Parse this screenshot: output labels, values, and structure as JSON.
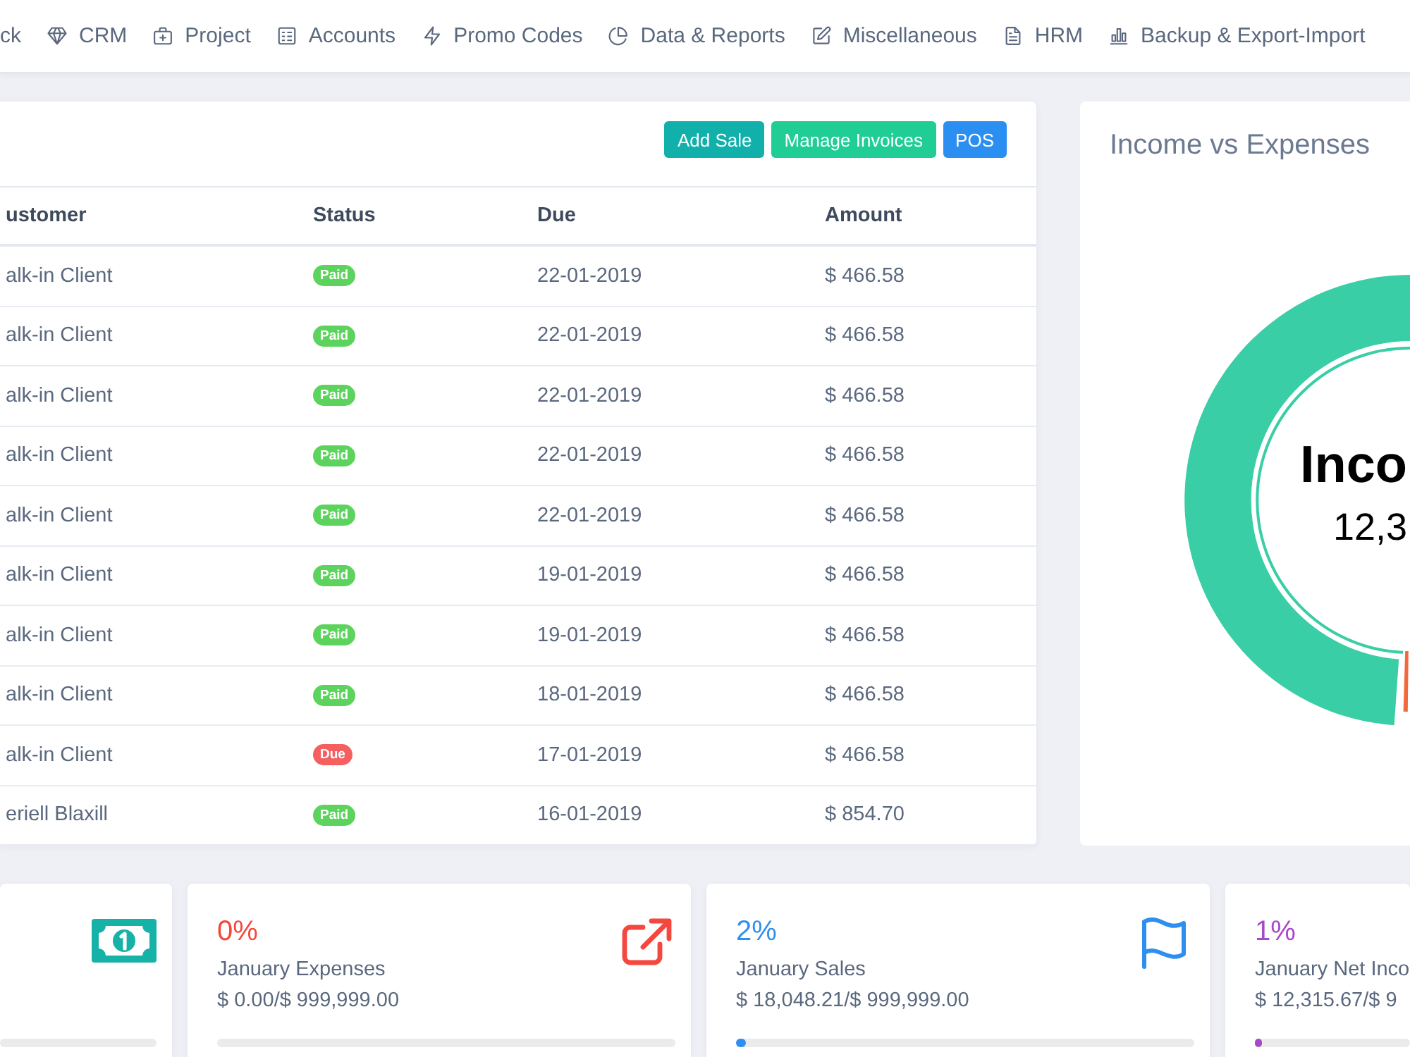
{
  "nav": {
    "items": [
      {
        "label": "ck"
      },
      {
        "label": "CRM"
      },
      {
        "label": "Project"
      },
      {
        "label": "Accounts"
      },
      {
        "label": "Promo Codes"
      },
      {
        "label": "Data & Reports"
      },
      {
        "label": "Miscellaneous"
      },
      {
        "label": "HRM"
      },
      {
        "label": "Backup & Export-Import"
      }
    ]
  },
  "sales": {
    "buttons": [
      {
        "label": "Add Sale"
      },
      {
        "label": "Manage Invoices"
      },
      {
        "label": "POS"
      }
    ],
    "table": {
      "columns": [
        "ustomer",
        "Status",
        "Due",
        "Amount"
      ],
      "rows": [
        {
          "customer": "alk-in Client",
          "status": {
            "label": "Paid",
            "color": "#5cd35c"
          },
          "due": "22-01-2019",
          "amount": "$ 466.58"
        },
        {
          "customer": "alk-in Client",
          "status": {
            "label": "Paid",
            "color": "#5cd35c"
          },
          "due": "22-01-2019",
          "amount": "$ 466.58"
        },
        {
          "customer": "alk-in Client",
          "status": {
            "label": "Paid",
            "color": "#5cd35c"
          },
          "due": "22-01-2019",
          "amount": "$ 466.58"
        },
        {
          "customer": "alk-in Client",
          "status": {
            "label": "Paid",
            "color": "#5cd35c"
          },
          "due": "22-01-2019",
          "amount": "$ 466.58"
        },
        {
          "customer": "alk-in Client",
          "status": {
            "label": "Paid",
            "color": "#5cd35c"
          },
          "due": "22-01-2019",
          "amount": "$ 466.58"
        },
        {
          "customer": "alk-in Client",
          "status": {
            "label": "Paid",
            "color": "#5cd35c"
          },
          "due": "19-01-2019",
          "amount": "$ 466.58"
        },
        {
          "customer": "alk-in Client",
          "status": {
            "label": "Paid",
            "color": "#5cd35c"
          },
          "due": "19-01-2019",
          "amount": "$ 466.58"
        },
        {
          "customer": "alk-in Client",
          "status": {
            "label": "Paid",
            "color": "#5cd35c"
          },
          "due": "18-01-2019",
          "amount": "$ 466.58"
        },
        {
          "customer": "alk-in Client",
          "status": {
            "label": "Due",
            "color": "#f55f5f"
          },
          "due": "17-01-2019",
          "amount": "$ 466.58"
        },
        {
          "customer": "eriell Blaxill",
          "status": {
            "label": "Paid",
            "color": "#5cd35c"
          },
          "due": "16-01-2019",
          "amount": "$ 854.70"
        }
      ]
    }
  },
  "chart_card": {
    "title": "Income vs Expenses",
    "center_label": "Inco",
    "center_value": "12,3"
  },
  "cards": [
    {
      "color": "#16b2a8"
    },
    {
      "percent": "0%",
      "label": "January Expenses",
      "value": "$ 0.00/$ 999,999.00",
      "color": "#f4473d"
    },
    {
      "percent": "2%",
      "label": "January Sales",
      "value": "$ 18,048.21/$ 999,999.00",
      "level": 0.02,
      "color": "#2f8ff0"
    },
    {
      "percent": "1%",
      "label": "January Net Inco",
      "value": "$ 12,315.67/$ 9",
      "level": 0.01,
      "color": "#a748c8"
    }
  ]
}
